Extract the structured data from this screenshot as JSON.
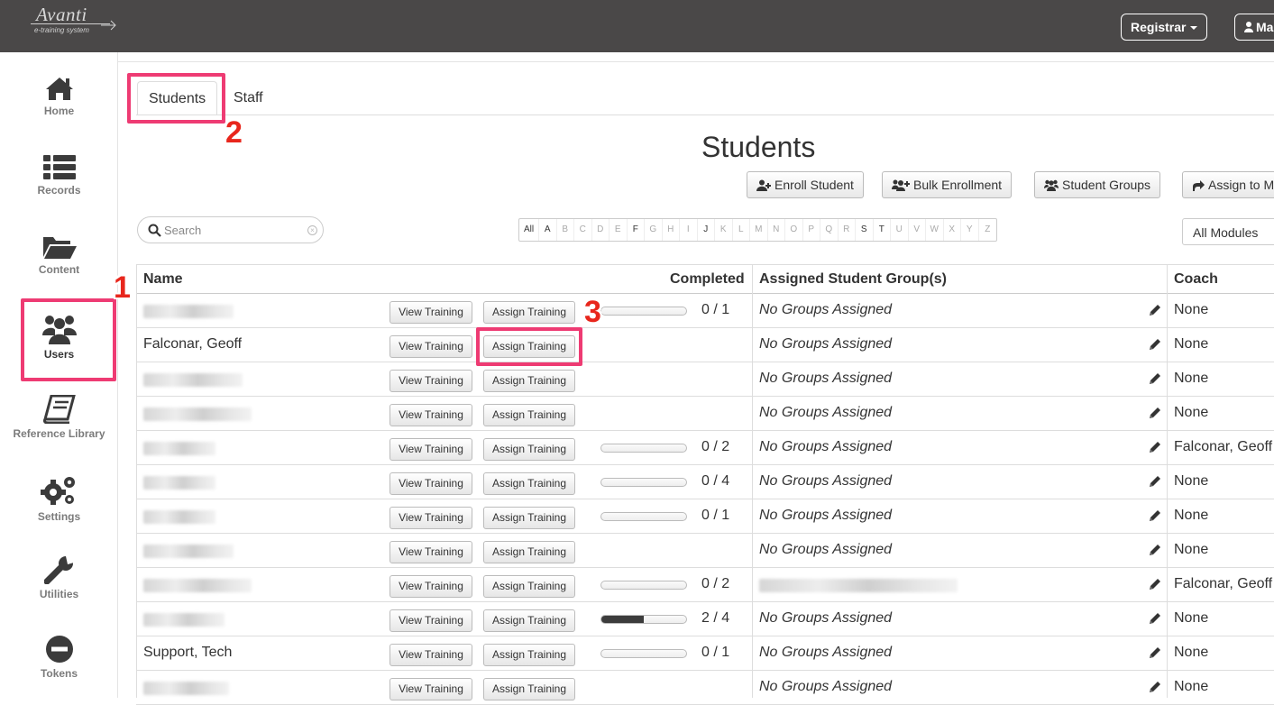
{
  "app": {
    "logo": "Avanti",
    "logo_sub": "e-training system"
  },
  "topbar": {
    "registrar_label": "Registrar",
    "user_label": "Ma"
  },
  "sidebar": {
    "items": [
      {
        "label": "Home",
        "icon": "home-icon"
      },
      {
        "label": "Records",
        "icon": "list-icon"
      },
      {
        "label": "Content",
        "icon": "folder-open-icon"
      },
      {
        "label": "Users",
        "icon": "users-icon",
        "active": true
      },
      {
        "label": "Reference Library",
        "icon": "book-icon"
      },
      {
        "label": "Settings",
        "icon": "gears-icon"
      },
      {
        "label": "Utilities",
        "icon": "wrench-icon"
      },
      {
        "label": "Tokens",
        "icon": "minus-circle-icon"
      }
    ]
  },
  "markers": [
    "1",
    "2",
    "3"
  ],
  "tabs": [
    {
      "label": "Students",
      "active": true
    },
    {
      "label": "Staff"
    }
  ],
  "page_title": "Students",
  "actions": {
    "enroll": "Enroll Student",
    "bulk": "Bulk Enrollment",
    "groups": "Student Groups",
    "assign": "Assign to M"
  },
  "search": {
    "placeholder": "Search"
  },
  "alphabet": {
    "letters": [
      "All",
      "A",
      "B",
      "C",
      "D",
      "E",
      "F",
      "G",
      "H",
      "I",
      "J",
      "K",
      "L",
      "M",
      "N",
      "O",
      "P",
      "Q",
      "R",
      "S",
      "T",
      "U",
      "V",
      "W",
      "X",
      "Y",
      "Z"
    ],
    "enabled": [
      "All",
      "A",
      "F",
      "J",
      "S",
      "T"
    ]
  },
  "module_filter": "All Modules",
  "table": {
    "headers": {
      "name": "Name",
      "completed": "Completed",
      "groups": "Assigned Student Group(s)",
      "coach": "Coach"
    },
    "view_label": "View Training",
    "assign_label": "Assign Training",
    "rows": [
      {
        "name": "",
        "progress": 0,
        "count": "0 / 1",
        "group": "No Groups Assigned",
        "coach": "None"
      },
      {
        "name": "Falconar, Geoff",
        "progress": null,
        "count": "",
        "group": "No Groups Assigned",
        "coach": "None"
      },
      {
        "name": "",
        "progress": null,
        "count": "",
        "group": "No Groups Assigned",
        "coach": "None"
      },
      {
        "name": "",
        "progress": null,
        "count": "",
        "group": "No Groups Assigned",
        "coach": "None"
      },
      {
        "name": "",
        "progress": 0,
        "count": "0 / 2",
        "group": "No Groups Assigned",
        "coach": "Falconar, Geoff"
      },
      {
        "name": "",
        "progress": 0,
        "count": "0 / 4",
        "group": "No Groups Assigned",
        "coach": "None"
      },
      {
        "name": "",
        "progress": 0,
        "count": "0 / 1",
        "group": "No Groups Assigned",
        "coach": "None"
      },
      {
        "name": "",
        "progress": null,
        "count": "",
        "group": "No Groups Assigned",
        "coach": "None"
      },
      {
        "name": "",
        "progress": 0,
        "count": "0 / 2",
        "group": "",
        "coach": "Falconar, Geoff"
      },
      {
        "name": "",
        "progress": 0.5,
        "count": "2 / 4",
        "group": "No Groups Assigned",
        "coach": "None"
      },
      {
        "name": "Support, Tech",
        "progress": 0,
        "count": "0 / 1",
        "group": "No Groups Assigned",
        "coach": "None"
      },
      {
        "name": "",
        "progress": null,
        "count": "",
        "group": "No Groups Assigned",
        "coach": "None"
      }
    ]
  },
  "colors": {
    "topbar": "#4a4848",
    "highlight": "#ee3b73",
    "marker": "#e8261c",
    "progress_fill": "#3c3c3c"
  }
}
